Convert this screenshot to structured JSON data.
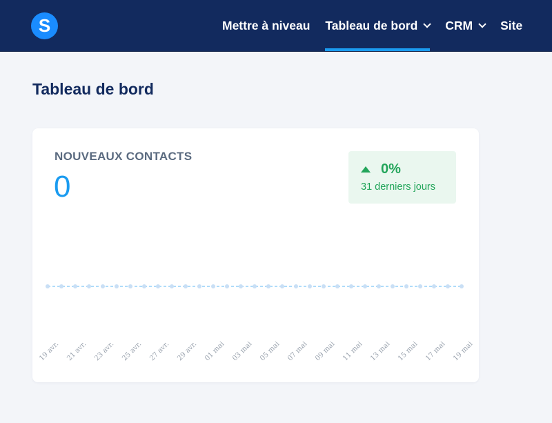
{
  "brand": {
    "logo_letter": "S"
  },
  "nav": [
    {
      "label": "Mettre à niveau",
      "has_chevron": false,
      "active": false
    },
    {
      "label": "Tableau de bord",
      "has_chevron": true,
      "active": true
    },
    {
      "label": "CRM",
      "has_chevron": true,
      "active": false
    },
    {
      "label": "Site",
      "has_chevron": false,
      "active": false
    }
  ],
  "page": {
    "title": "Tableau de bord"
  },
  "card": {
    "label": "NOUVEAUX CONTACTS",
    "value": "0",
    "trend": {
      "value": "0%",
      "period": "31 derniers jours",
      "color": "#22a55a"
    }
  },
  "chart_data": {
    "type": "line",
    "x": [
      "19 avr.",
      "20 avr.",
      "21 avr.",
      "22 avr.",
      "23 avr.",
      "24 avr.",
      "25 avr.",
      "26 avr.",
      "27 avr.",
      "28 avr.",
      "29 avr.",
      "30 avr.",
      "01 mai",
      "02 mai",
      "03 mai",
      "04 mai",
      "05 mai",
      "06 mai",
      "07 mai",
      "08 mai",
      "09 mai",
      "10 mai",
      "11 mai",
      "12 mai",
      "13 mai",
      "14 mai",
      "15 mai",
      "16 mai",
      "17 mai",
      "18 mai",
      "19 mai"
    ],
    "series": [
      {
        "values": [
          0,
          0,
          0,
          0,
          0,
          0,
          0,
          0,
          0,
          0,
          0,
          0,
          0,
          0,
          0,
          0,
          0,
          0,
          0,
          0,
          0,
          0,
          0,
          0,
          0,
          0,
          0,
          0,
          0,
          0,
          0
        ]
      }
    ],
    "tick_labels": [
      "19 avr.",
      "21 avr.",
      "23 avr.",
      "25 avr.",
      "27 avr.",
      "29 avr.",
      "01 mai",
      "03 mai",
      "05 mai",
      "07 mai",
      "09 mai",
      "11 mai",
      "13 mai",
      "15 mai",
      "17 mai",
      "19 mai"
    ],
    "line_color": "#1a9bf0"
  }
}
